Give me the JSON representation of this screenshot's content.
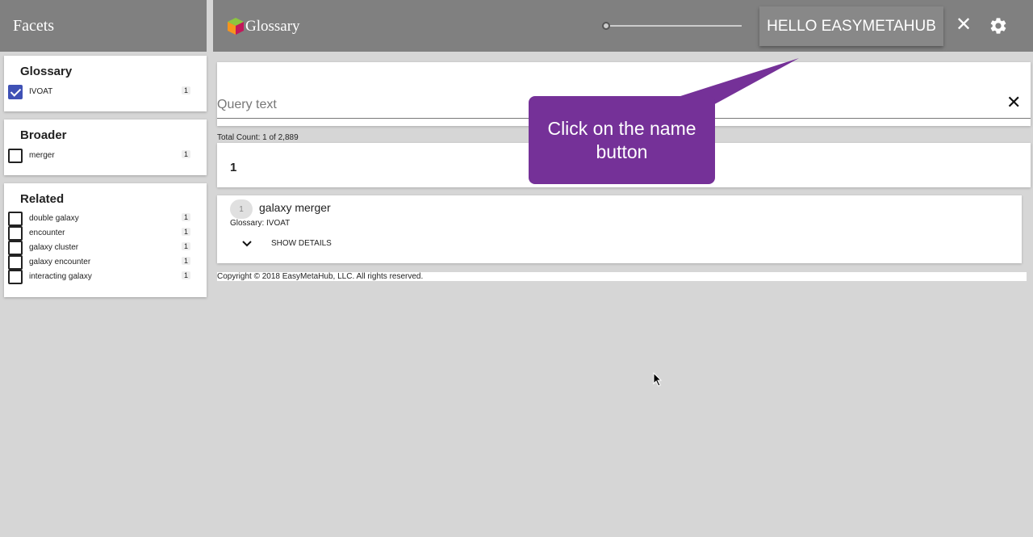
{
  "sidebar": {
    "header": "Facets",
    "groups": [
      {
        "title": "Glossary",
        "items": [
          {
            "label": "IVOAT",
            "count": "1",
            "checked": true
          }
        ]
      },
      {
        "title": "Broader",
        "items": [
          {
            "label": "merger",
            "count": "1",
            "checked": false
          }
        ]
      },
      {
        "title": "Related",
        "items": [
          {
            "label": "double galaxy",
            "count": "1",
            "checked": false
          },
          {
            "label": "encounter",
            "count": "1",
            "checked": false
          },
          {
            "label": "galaxy cluster",
            "count": "1",
            "checked": false
          },
          {
            "label": "galaxy encounter",
            "count": "1",
            "checked": false
          },
          {
            "label": "interacting galaxy",
            "count": "1",
            "checked": false
          }
        ]
      }
    ]
  },
  "topbar": {
    "title": "Glossary",
    "user_button": "HELLO EASYMETAHUB",
    "close_icon": "close-icon",
    "settings_icon": "gear-icon"
  },
  "search": {
    "placeholder": "Query text",
    "value": ""
  },
  "results": {
    "total_count": "Total Count: 1 of 2,889",
    "page": "1",
    "items": [
      {
        "rank": "1",
        "title": "galaxy merger",
        "glossary": "Glossary: IVOAT",
        "details_label": "SHOW DETAILS"
      }
    ]
  },
  "footer": "Copyright © 2018 EasyMetaHub, LLC. All rights reserved.",
  "tooltip": "Click on the name button",
  "colors": {
    "bar": "#808080",
    "tooltip": "#753198",
    "checkbox": "#3f51b5",
    "background": "#d6d6d6"
  }
}
